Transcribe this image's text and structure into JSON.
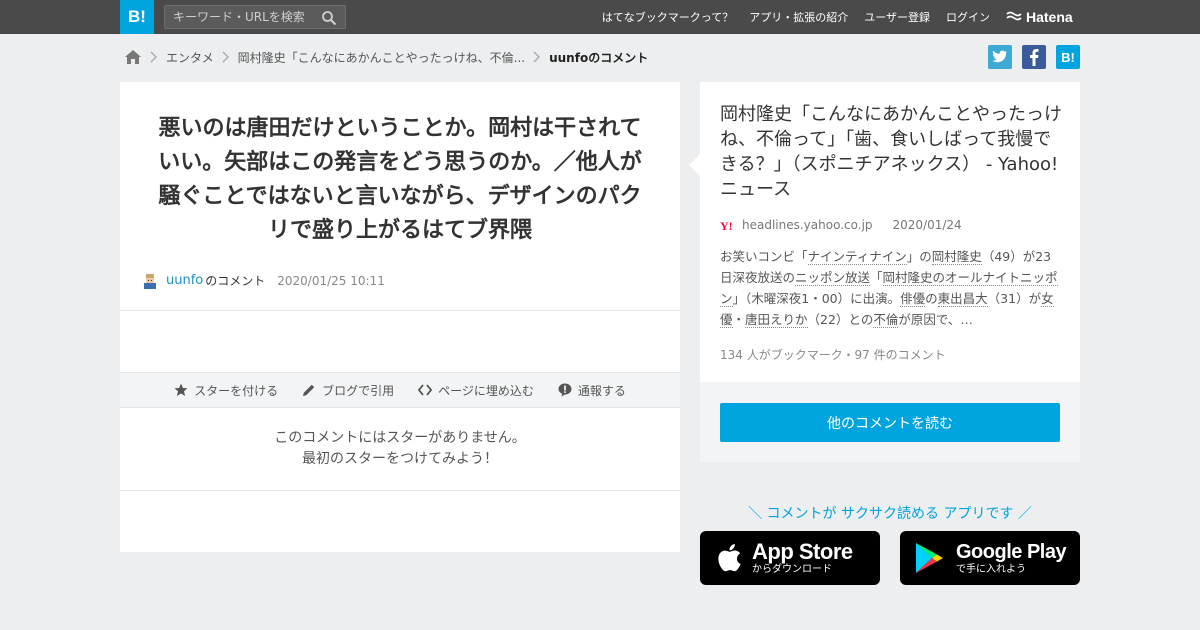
{
  "header": {
    "logo": "B!",
    "search_placeholder": "キーワード・URLを検索",
    "nav": [
      "はてなブックマークって？",
      "アプリ・拡張の紹介",
      "ユーザー登録",
      "ログイン"
    ],
    "brand": "Hatena"
  },
  "breadcrumb": {
    "items": [
      "エンタメ",
      "岡村隆史「こんなにあかんことやったっけね、不倫...",
      "uunfoのコメント"
    ]
  },
  "share": {
    "hatebu": "B!"
  },
  "comment": {
    "text": "悪いのは唐田だけということか。岡村は干されていい。矢部はこの発言をどう思うのか。／他人が騒ぐことではないと言いながら、デザインのパクリで盛り上がるはてブ界隈",
    "user": "uunfo",
    "user_suffix": "のコメント",
    "date": "2020/01/25 10:11",
    "actions": [
      "スターを付ける",
      "ブログで引用",
      "ページに埋め込む",
      "通報する"
    ],
    "no_star_line1": "このコメントにはスターがありません。",
    "no_star_line2": "最初のスターをつけてみよう！"
  },
  "entry": {
    "title": "岡村隆史「こんなにあかんことやったっけね、不倫って」「歯、食いしばって我慢できる？」（スポニチアネックス） - Yahoo!ニュース",
    "domain": "headlines.yahoo.co.jp",
    "date": "2020/01/24",
    "desc": [
      {
        "t": "お笑いコンビ「",
        "kw": false
      },
      {
        "t": "ナインティナイン",
        "kw": true
      },
      {
        "t": "」の",
        "kw": false
      },
      {
        "t": "岡村隆史",
        "kw": true
      },
      {
        "t": "（49）が23日深夜放送の",
        "kw": false
      },
      {
        "t": "ニッポン放送",
        "kw": true
      },
      {
        "t": "「",
        "kw": false
      },
      {
        "t": "岡村隆史のオールナイトニッポン",
        "kw": true
      },
      {
        "t": "」（木曜深夜1・00）に出演。",
        "kw": false
      },
      {
        "t": "俳優",
        "kw": true
      },
      {
        "t": "の",
        "kw": false
      },
      {
        "t": "東出昌大",
        "kw": true
      },
      {
        "t": "（31）が",
        "kw": false
      },
      {
        "t": "女優",
        "kw": true
      },
      {
        "t": "・",
        "kw": false
      },
      {
        "t": "唐田えりか",
        "kw": true
      },
      {
        "t": "（22）との",
        "kw": false
      },
      {
        "t": "不倫",
        "kw": true
      },
      {
        "t": "が原因で、…",
        "kw": false
      }
    ],
    "stats": "134 人がブックマーク・97 件のコメント",
    "read_button": "他のコメントを読む"
  },
  "promo": {
    "text": "＼ コメントが サクサク読める アプリです ／",
    "app_store_name": "App Store",
    "app_store_sub": "からダウンロード",
    "google_play_name": "Google Play",
    "google_play_sub": "で手に入れよう"
  },
  "colors": {
    "accent": "#00a4de",
    "topbar": "#4a4a4a",
    "background": "#eceeef"
  }
}
